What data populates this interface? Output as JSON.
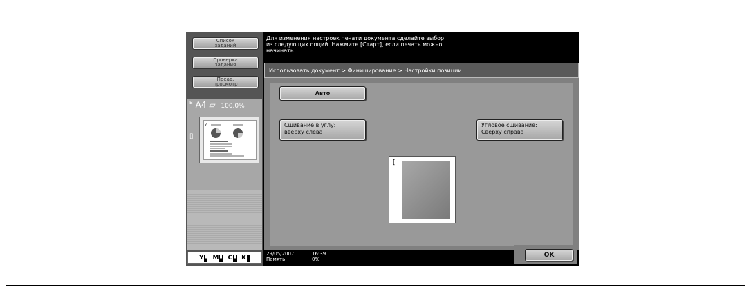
{
  "left_panel": {
    "job_list_label": "Список\nзаданий",
    "check_job_label": "Проверка\nзадания",
    "preview_label": "Преав.\nпросмотр",
    "paper_marker": "B",
    "paper_size": "A4",
    "orientation_glyph": "▱",
    "zoom": "100.0%",
    "toner": [
      {
        "label": "Y",
        "level": 0.5
      },
      {
        "label": "M",
        "level": 0.5
      },
      {
        "label": "C",
        "level": 0.5
      },
      {
        "label": "K",
        "level": 1.0
      }
    ]
  },
  "message": "Для изменения настроек печати документа сделайте выбор\nиз следующих опций. Нажмите [Старт], если печать можно\nначинать.",
  "breadcrumb": "Использовать документ > Финиширование > Настройки позиции",
  "buttons": {
    "auto": "Авто",
    "corner_top_left": "Сшивание в углу:\nвверху слева",
    "corner_top_right": "Угловое сшивание:\nСверху справа",
    "ok": "OK"
  },
  "status": {
    "date": "29/05/2007",
    "time": "16:39",
    "memory_label": "Память",
    "memory_value": "0%"
  }
}
